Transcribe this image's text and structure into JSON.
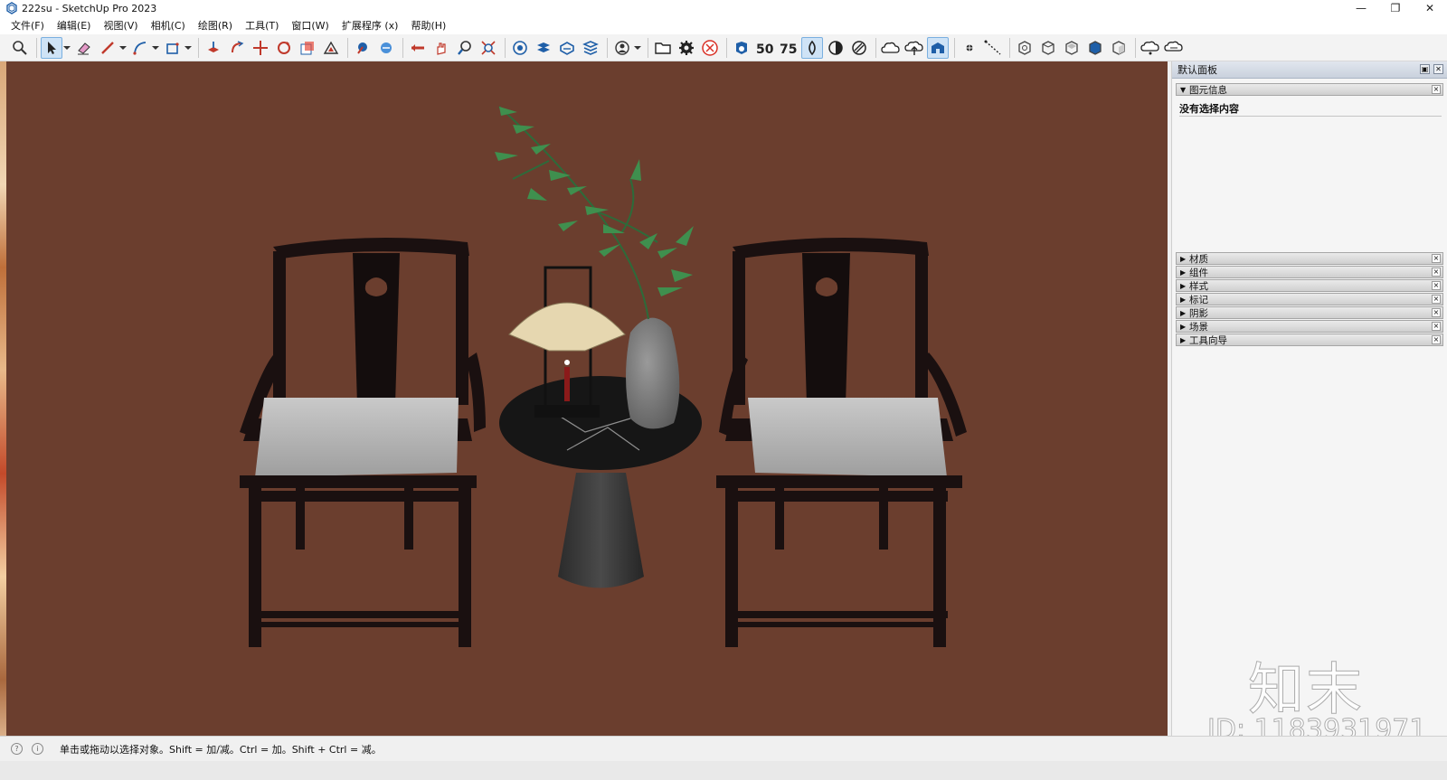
{
  "window": {
    "title": "222su - SketchUp Pro 2023",
    "controls": [
      "—",
      "❐",
      "✕"
    ]
  },
  "menubar": {
    "items": [
      "文件(F)",
      "编辑(E)",
      "视图(V)",
      "相机(C)",
      "绘图(R)",
      "工具(T)",
      "窗口(W)",
      "扩展程序 (x)",
      "帮助(H)"
    ]
  },
  "toolbar": {
    "icons": [
      "zoom-icon",
      "select-icon",
      "eraser-icon",
      "pencil-icon",
      "arc-icon",
      "shape-icon",
      "push-pull-icon",
      "follow-me-icon",
      "move-icon",
      "rotate-icon",
      "scale-icon",
      "offset-icon",
      "tape-icon",
      "protractor-icon",
      "orbit-icon",
      "pan-icon",
      "zoom-tool-icon",
      "zoom-extents-icon",
      "section-icon",
      "layers-icon",
      "materials-icon",
      "components-icon",
      "account-icon",
      "folder-icon",
      "gear-icon",
      "close-circle-icon",
      "view-icon",
      "50-icon",
      "75-icon",
      "xray-icon",
      "shade-icon",
      "hidden-line-icon",
      "cloud-icon",
      "cloud-upload-icon",
      "warehouse-icon",
      "dot-icon",
      "line-icon",
      "iso-icon",
      "top-icon",
      "front-icon",
      "right-icon",
      "back-icon",
      "cloud-sync-icon",
      "cloud-sync2-icon"
    ]
  },
  "viewport": {
    "background": "#6b3e2e"
  },
  "tray": {
    "title": "默认面板",
    "entity_info": {
      "label": "图元信息",
      "content": "没有选择内容"
    },
    "sections": [
      "材质",
      "组件",
      "样式",
      "标记",
      "阴影",
      "场景",
      "工具向导"
    ]
  },
  "watermark": {
    "logo": "知末",
    "id": "ID: 1183931971"
  },
  "statusbar": {
    "text": "单击或拖动以选择对象。Shift = 加/减。Ctrl = 加。Shift + Ctrl = 减。"
  }
}
